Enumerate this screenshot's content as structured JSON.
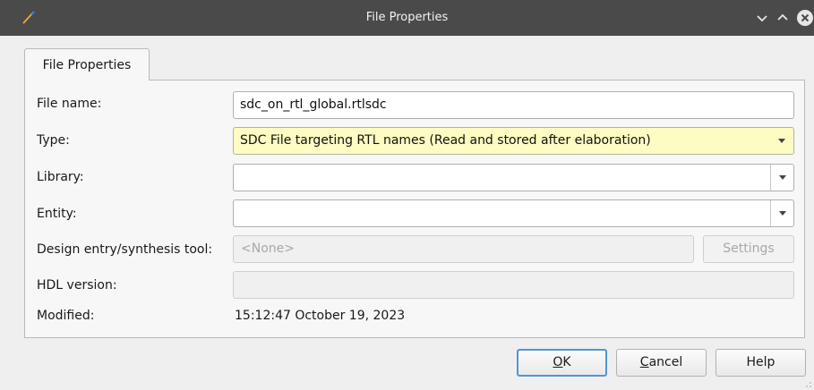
{
  "window": {
    "title": "File Properties",
    "icons": [
      "app-brush-icon",
      "minimize-chevron-icon",
      "maximize-chevron-icon",
      "close-circle-icon"
    ]
  },
  "tabs": [
    {
      "label": "File Properties",
      "active": true
    }
  ],
  "form": {
    "file_name": {
      "label": "File name:",
      "value": "sdc_on_rtl_global.rtlsdc"
    },
    "type": {
      "label": "Type:",
      "value": "SDC File targeting RTL names (Read and stored after elaboration)",
      "highlight_color": "#fdfcc2"
    },
    "library": {
      "label": "Library:",
      "value": ""
    },
    "entity": {
      "label": "Entity:",
      "value": ""
    },
    "design_tool": {
      "label": "Design entry/synthesis tool:",
      "value": "<None>",
      "settings_label": "Settings",
      "disabled": true
    },
    "hdl_version": {
      "label": "HDL version:",
      "value": "",
      "disabled": true
    },
    "modified": {
      "label": "Modified:",
      "value": "15:12:47 October 19, 2023"
    }
  },
  "buttons": {
    "ok": {
      "mnemonic": "O",
      "rest": "K"
    },
    "cancel": {
      "mnemonic": "C",
      "rest": "ancel"
    },
    "help": {
      "label": "Help"
    }
  },
  "colors": {
    "titlebar": "#4a4a4a",
    "focus": "#4f97d6",
    "accent": "#fdfcc2"
  }
}
